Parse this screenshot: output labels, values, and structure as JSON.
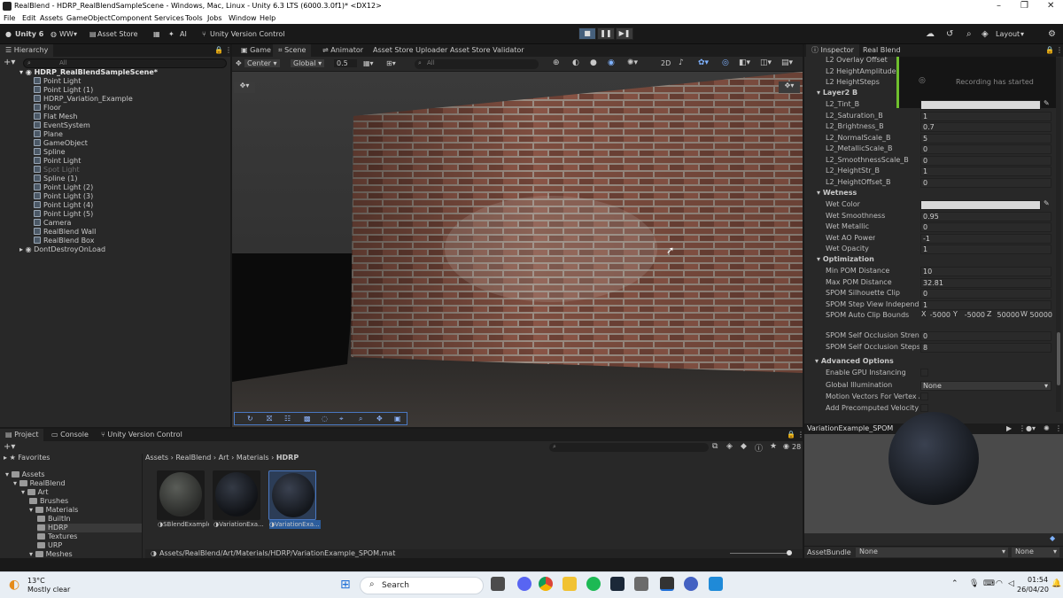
{
  "window": {
    "title": "RealBlend - HDRP_RealBlendSampleScene - Windows, Mac, Linux - Unity 6.3 LTS (6000.3.0f1)* <DX12>"
  },
  "menu": [
    "File",
    "Edit",
    "Assets",
    "GameObject",
    "Component",
    "Services",
    "Tools",
    "Jobs",
    "Window",
    "Help"
  ],
  "toolbar": {
    "unity_label": "Unity 6",
    "account": "WW",
    "asset_store": "Asset Store",
    "ai": "AI",
    "version_control": "Unity Version Control",
    "layout": "Layout"
  },
  "hierarchy": {
    "title": "Hierarchy",
    "search_placeholder": "All",
    "scene": "HDRP_RealBlendSampleScene*",
    "items": [
      "Point Light",
      "Point Light (1)",
      "HDRP_Variation_Example",
      "Floor",
      "Flat Mesh",
      "EventSystem",
      "Plane",
      "GameObject",
      "Spline",
      "Point Light",
      "Spot Light",
      "Spline (1)",
      "Point Light (2)",
      "Point Light (3)",
      "Point Light (4)",
      "Point Light (5)",
      "Camera",
      "RealBlend Wall",
      "RealBlend Box"
    ],
    "dont_destroy": "DontDestroyOnLoad"
  },
  "scene_tabs": [
    "Game",
    "Scene",
    "Animator",
    "Asset Store Uploader",
    "Asset Store Validator"
  ],
  "scene_toolbar": {
    "pivot": "Center",
    "space": "Global",
    "snap": "0.5",
    "search_placeholder": "All",
    "mode_2d": "2D"
  },
  "inspector": {
    "tabs": [
      "Inspector",
      "Real Blend"
    ],
    "top_rows": [
      "L2 Overlay Offset",
      "L2 HeightAmplitude",
      "L2 HeightSteps"
    ],
    "recording": "Recording has started",
    "sections": {
      "layer2b": "Layer2 B",
      "wetness": "Wetness",
      "optimization": "Optimization",
      "advanced": "Advanced Options"
    },
    "layer2b_rows": [
      {
        "label": "L2_Tint_B",
        "value": ""
      },
      {
        "label": "L2_Saturation_B",
        "value": "1"
      },
      {
        "label": "L2_Brightness_B",
        "value": "0.7"
      },
      {
        "label": "L2_NormalScale_B",
        "value": "5"
      },
      {
        "label": "L2_MetallicScale_B",
        "value": "0"
      },
      {
        "label": "L2_SmoothnessScale_B",
        "value": "0"
      },
      {
        "label": "L2_HeightStr_B",
        "value": "1"
      },
      {
        "label": "L2_HeightOffset_B",
        "value": "0"
      }
    ],
    "wet_rows": [
      {
        "label": "Wet Color",
        "value": ""
      },
      {
        "label": "Wet Smoothness",
        "value": "0.95"
      },
      {
        "label": "Wet Metallic",
        "value": "0"
      },
      {
        "label": "Wet AO Power",
        "value": "-1"
      },
      {
        "label": "Wet Opacity",
        "value": "1"
      }
    ],
    "opt_rows": [
      {
        "label": "Min POM Distance",
        "value": "10"
      },
      {
        "label": "Max POM Distance",
        "value": "32.81"
      },
      {
        "label": "SPOM Silhouette Clip",
        "value": "0"
      },
      {
        "label": "SPOM Step View Independen",
        "value": "1"
      }
    ],
    "auto_clip": {
      "label": "SPOM Auto Clip Bounds",
      "x": "-5000",
      "y": "-5000",
      "z": "50000",
      "w": "50000",
      "xl": "X",
      "yl": "Y",
      "zl": "Z",
      "wl": "W"
    },
    "self_occ": [
      {
        "label": "SPOM Self Occlusion Strength",
        "value": "0"
      },
      {
        "label": "SPOM Self Occlusion Steps",
        "value": "8"
      }
    ],
    "adv_rows": {
      "gpu": "Enable GPU Instancing",
      "gi": "Global Illumination",
      "gi_value": "None",
      "motion": "Motion Vectors For Vertex Ani",
      "precomp": "Add Precomputed Velocity"
    }
  },
  "preview": {
    "title": "VariationExample_SPOM",
    "assetbundle": "AssetBundle",
    "ab_value": "None",
    "ab_variant": "None"
  },
  "project": {
    "tabs": [
      "Project",
      "Console",
      "Unity Version Control"
    ],
    "favorites": "Favorites",
    "tree": [
      {
        "label": "Assets",
        "indent": 0
      },
      {
        "label": "RealBlend",
        "indent": 1
      },
      {
        "label": "Art",
        "indent": 2
      },
      {
        "label": "Brushes",
        "indent": 3
      },
      {
        "label": "Materials",
        "indent": 3
      },
      {
        "label": "BuiltIn",
        "indent": 4
      },
      {
        "label": "HDRP",
        "indent": 4
      },
      {
        "label": "Textures",
        "indent": 4
      },
      {
        "label": "URP",
        "indent": 4
      },
      {
        "label": "Meshes",
        "indent": 3
      }
    ],
    "breadcrumb": [
      "Assets",
      "RealBlend",
      "Art",
      "Materials",
      "HDRP"
    ],
    "count": "28",
    "assets": [
      "SBlendExample",
      "VariationExa...",
      "VariationExa..."
    ],
    "path": "Assets/RealBlend/Art/Materials/HDRP/VariationExample_SPOM.mat"
  },
  "taskbar": {
    "temp": "13°C",
    "weather": "Mostly clear",
    "search": "Search",
    "time": "01:54",
    "date": "26/04/20"
  }
}
